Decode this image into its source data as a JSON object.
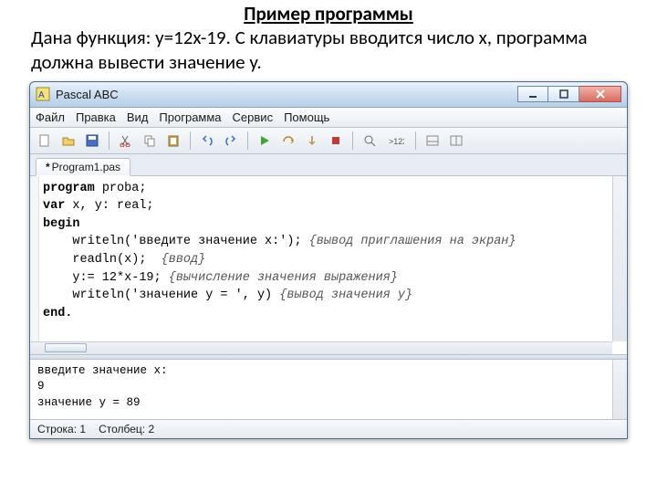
{
  "slide": {
    "title": "Пример программы",
    "body": "Дана функция: y=12x-19. С клавиатуры вводится число x, программа должна вывести значение y."
  },
  "window": {
    "title": "Pascal ABC"
  },
  "menu": {
    "file": "Файл",
    "edit": "Правка",
    "view": "Вид",
    "program": "Программа",
    "service": "Сервис",
    "help": "Помощь"
  },
  "toolbar_icons": {
    "new": "new-file-icon",
    "open": "open-icon",
    "save": "save-icon",
    "cut": "cut-icon",
    "copy": "copy-icon",
    "paste": "paste-icon",
    "undo": "undo-icon",
    "redo": "redo-icon",
    "run": "run-icon",
    "step_over": "step-over-icon",
    "step_into": "step-into-icon",
    "stop": "stop-icon",
    "eval": "eval-icon",
    "out1": "output-icon",
    "out2": "output2-icon"
  },
  "tab": {
    "modified": "*",
    "filename": "Program1.pas"
  },
  "code": {
    "l1a": "program",
    "l1b": " proba;",
    "l2a": "var",
    "l2b": " x, y: real;",
    "l3a": "begin",
    "l4a": "    writeln(",
    "l4s": "'введите значение x:'",
    "l4b": "); ",
    "l4c": "{вывод приглашения на экран}",
    "l5a": "    readln(x);  ",
    "l5c": "{ввод}",
    "l6a": "    y:= 12*x-19; ",
    "l6c": "{вычисление значения выражения}",
    "l7a": "    writeln(",
    "l7s": "'значение y = '",
    "l7b": ", y) ",
    "l7c": "{вывод значения y}",
    "l8a": "end."
  },
  "output": {
    "line1": "введите значение x:",
    "line2": "9",
    "line3": "значение y = 89"
  },
  "status": {
    "row_label": "Строка:",
    "row_value": "1",
    "col_label": "Столбец:",
    "col_value": "2"
  }
}
